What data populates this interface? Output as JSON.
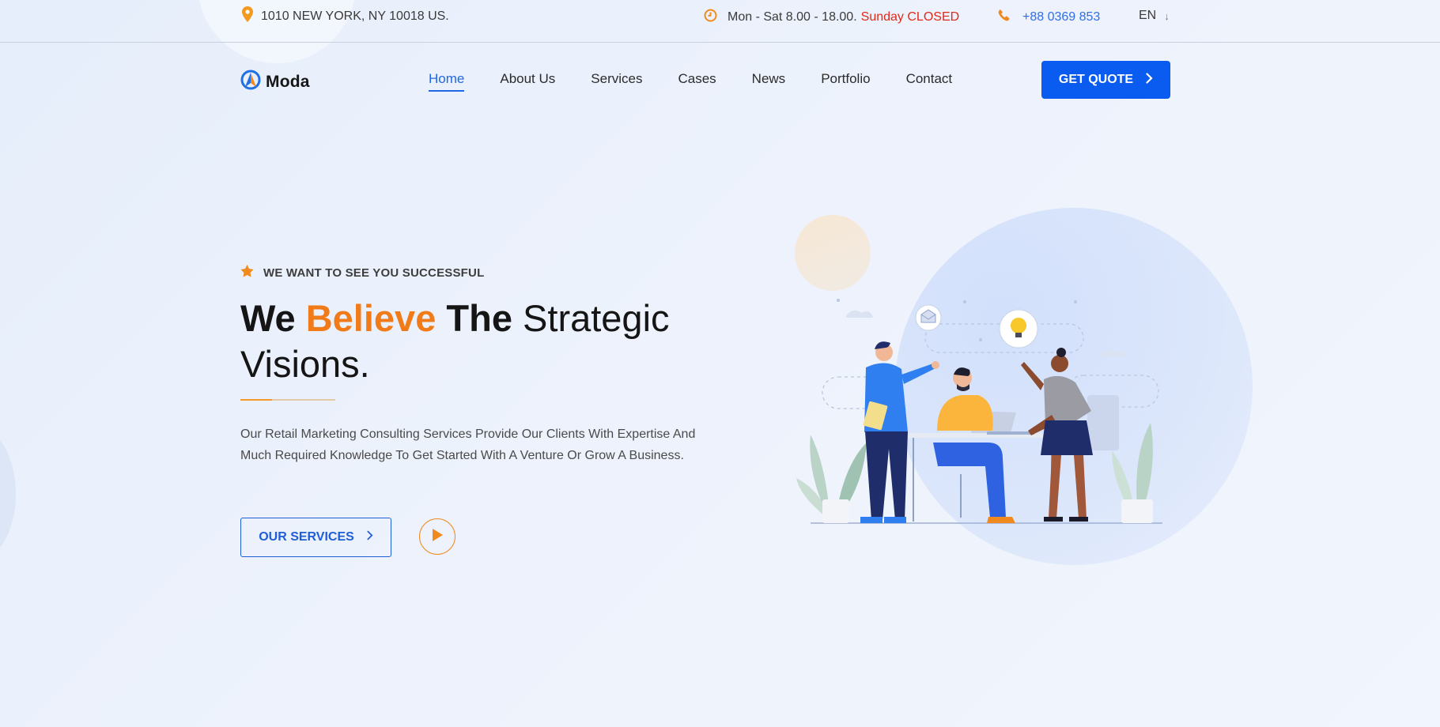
{
  "topbar": {
    "address": "1010 NEW YORK, NY 10018 US.",
    "hours": "Mon - Sat 8.00 - 18.00.",
    "closed": "Sunday CLOSED",
    "phone": "+88 0369 853",
    "language": "EN",
    "language_arrow": "↓"
  },
  "logo": {
    "text": "Moda"
  },
  "nav": {
    "items": [
      {
        "label": "Home"
      },
      {
        "label": "About Us"
      },
      {
        "label": "Services"
      },
      {
        "label": "Cases"
      },
      {
        "label": "News"
      },
      {
        "label": "Portfolio"
      },
      {
        "label": "Contact"
      }
    ],
    "active": "Home",
    "quote_label": "GET QUOTE"
  },
  "hero": {
    "tagline": "WE WANT TO SEE YOU SUCCESSFUL",
    "headline": {
      "word1": "We",
      "accent": "Believe",
      "word3": "The",
      "rest1": "Strategic",
      "rest2": "Visions."
    },
    "description": "Our Retail Marketing Consulting Services Provide Our Clients With Expertise And Much Required Knowledge To Get Started With A Venture Or Grow A Business.",
    "services_label": "OUR SERVICES"
  },
  "icons": {
    "address": "map-pin-icon",
    "hours": "clock-icon",
    "phone": "phone-icon",
    "tagline": "star-icon",
    "play": "play-icon"
  },
  "colors": {
    "accent_orange": "#f07b18",
    "primary_blue": "#0a5bf0",
    "closed_red": "#e0291a"
  }
}
